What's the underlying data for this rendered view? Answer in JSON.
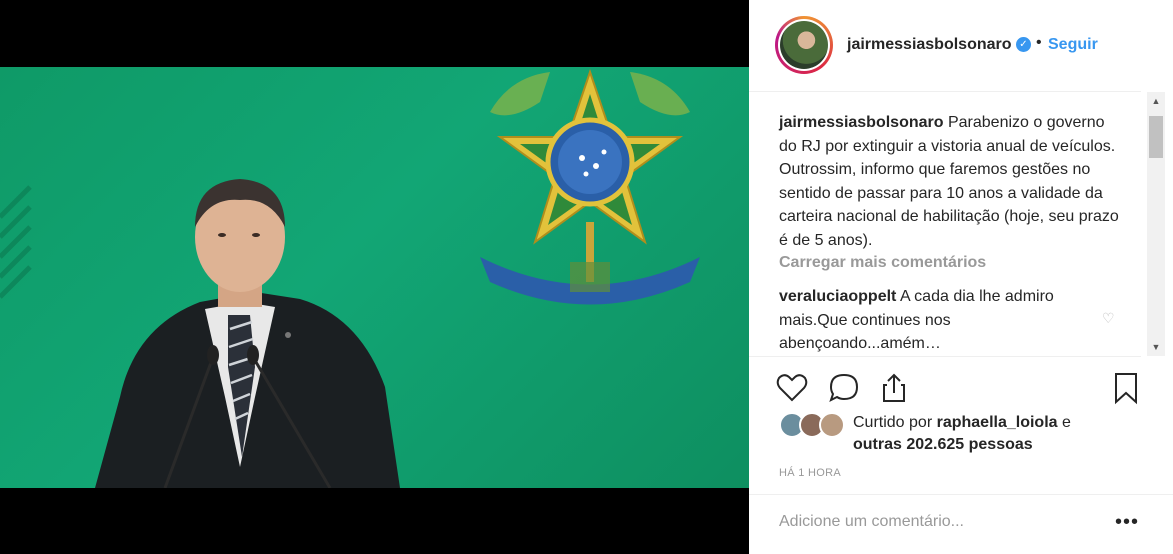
{
  "post": {
    "username": "jairmessiasbolsonaro",
    "follow_label": "Seguir",
    "separator": "•"
  },
  "caption": {
    "username": "jairmessiasbolsonaro",
    "text": "Parabenizo o governo do RJ por extinguir a vistoria anual de veículos. Outrossim, informo que faremos gestões no sentido de passar para 10 anos a validade da carteira nacional de habilitação (hoje, seu prazo é de 5 anos)."
  },
  "load_more_label": "Carregar mais comentários",
  "comments": [
    {
      "username": "veraluciaoppelt",
      "text": "A cada dia lhe admiro mais.Que continues nos abençoando...amém…"
    }
  ],
  "likes": {
    "prefix": "Curtido por",
    "user": "raphaella_loiola",
    "connector": "e",
    "others": "outras 202.625 pessoas"
  },
  "timestamp": "HÁ 1 HORA",
  "add_comment_placeholder": "Adicione um comentário...",
  "icons": {
    "verified": "verified-badge-icon",
    "like": "heart-icon",
    "comment": "speech-bubble-icon",
    "share": "share-icon",
    "save": "bookmark-icon",
    "comment_like": "small-heart-icon",
    "more": "ellipsis-icon"
  },
  "colors": {
    "accent": "#3897f0",
    "text": "#262626",
    "muted": "#999999",
    "photo_background": "#12a675"
  }
}
